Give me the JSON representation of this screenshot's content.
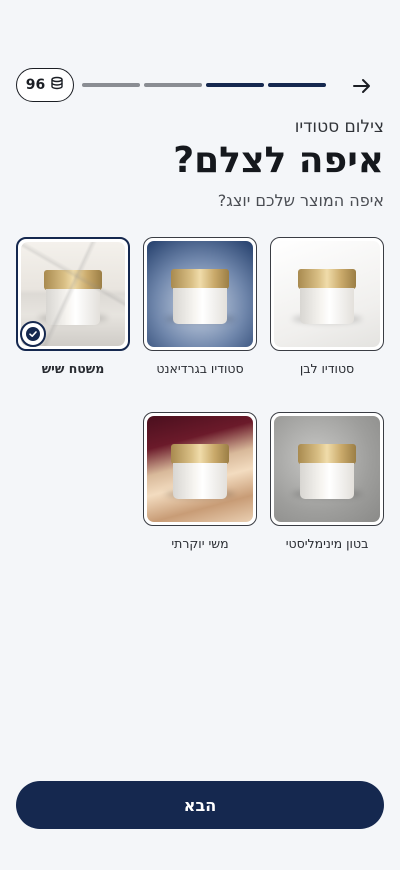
{
  "header": {
    "coins": "96",
    "progress_total": 4,
    "progress_active": 2
  },
  "eyebrow": "צילום סטודיו",
  "title": "איפה לצלם?",
  "subtitle": "איפה המוצר שלכם יוצג?",
  "options": [
    {
      "label": "סטודיו לבן",
      "bg": "white",
      "selected": false
    },
    {
      "label": "סטודיו בגרדיאנט",
      "bg": "gradient",
      "selected": false
    },
    {
      "label": "משטח שיש",
      "bg": "marble",
      "selected": true
    },
    {
      "label": "בטון מינימליסטי",
      "bg": "concrete",
      "selected": false
    },
    {
      "label": "משי יוקרתי",
      "bg": "silk",
      "selected": false
    }
  ],
  "next_button": "הבא",
  "colors": {
    "primary": "#15284f",
    "background": "#f4f6f9"
  }
}
